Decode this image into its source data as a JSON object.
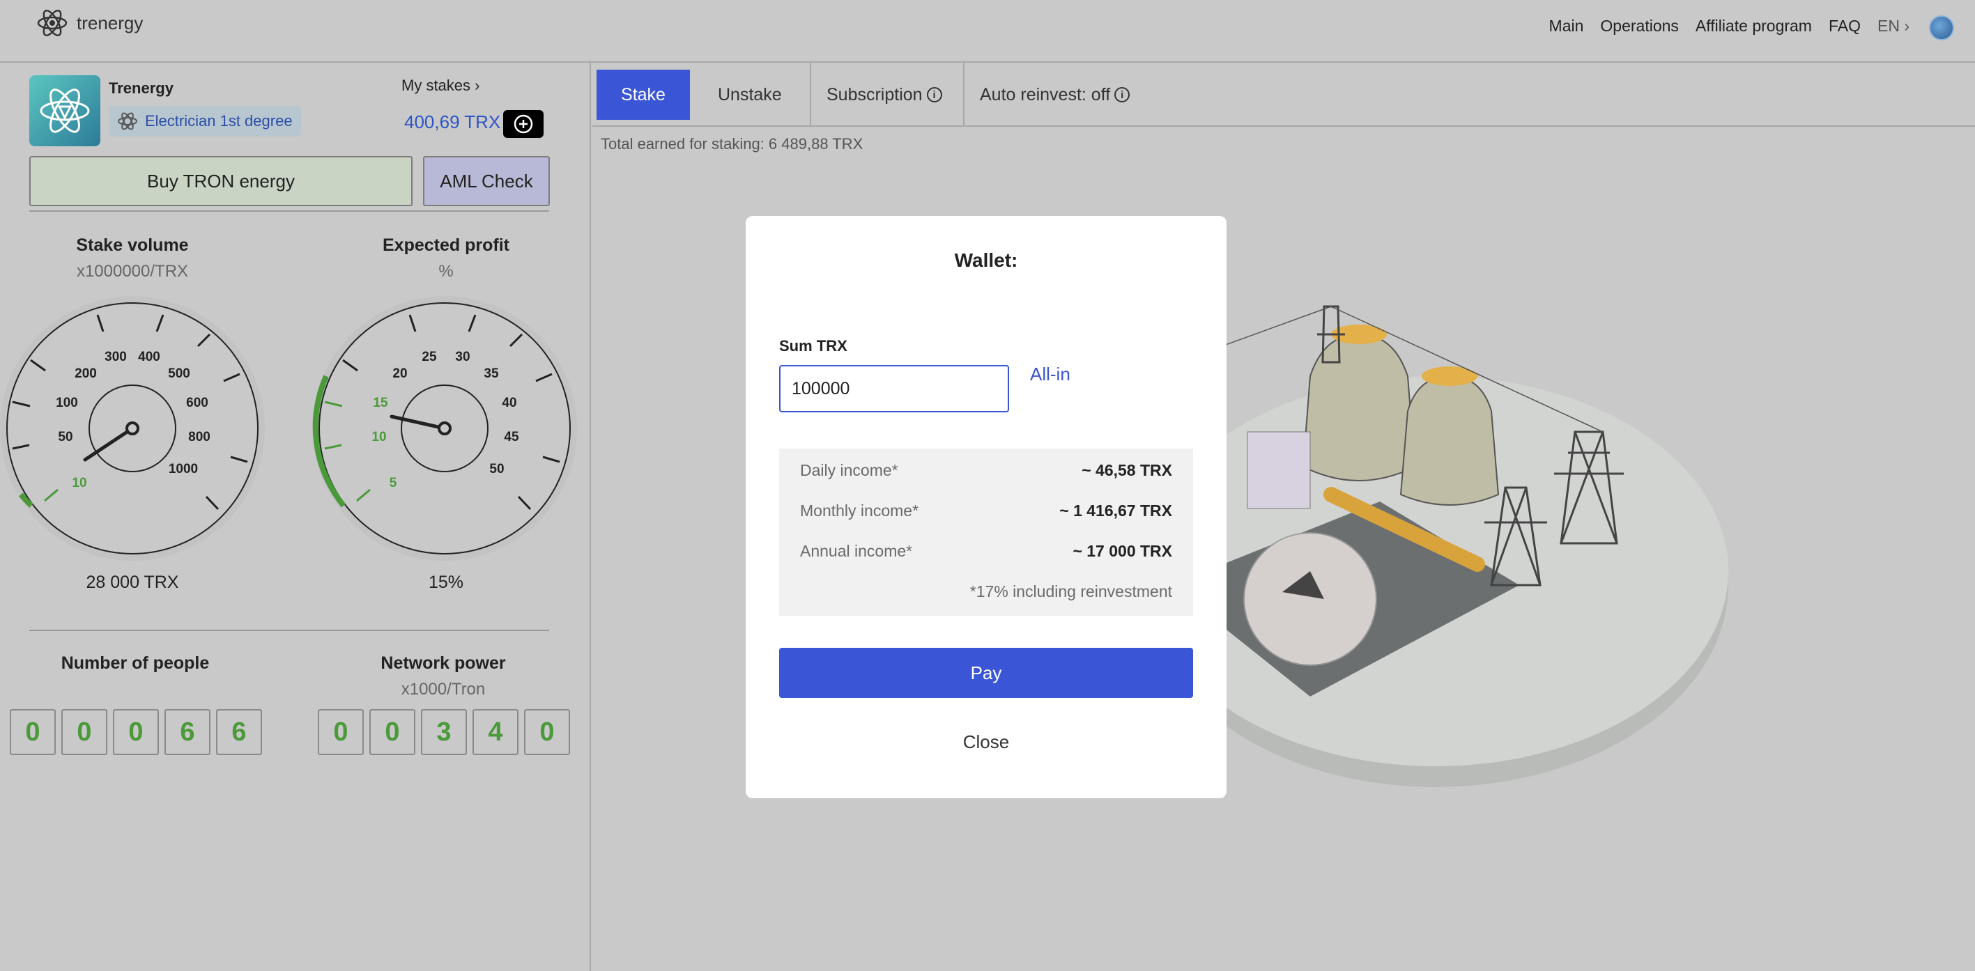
{
  "header": {
    "logo_text": "trenergy",
    "nav": [
      "Main",
      "Operations",
      "Affiliate program",
      "FAQ"
    ],
    "lang": "EN"
  },
  "profile": {
    "name": "Trenergy",
    "rank": "Electrician 1st degree",
    "my_stakes": "My stakes",
    "balance": "400,69 TRX"
  },
  "actions": {
    "buy_energy": "Buy TRON energy",
    "aml_check": "AML Check"
  },
  "gauges": {
    "stake": {
      "title": "Stake volume",
      "unit": "x1000000/TRX",
      "value": "28 000 TRX",
      "ticks": [
        "10",
        "50",
        "100",
        "200",
        "300",
        "400",
        "500",
        "600",
        "800",
        "1000"
      ]
    },
    "profit": {
      "title": "Expected profit",
      "unit": "%",
      "value": "15%",
      "ticks": [
        "5",
        "10",
        "15",
        "20",
        "25",
        "30",
        "35",
        "40",
        "45",
        "50"
      ]
    }
  },
  "counters": {
    "people": {
      "title": "Number of people",
      "unit": "",
      "digits": [
        "0",
        "0",
        "0",
        "6",
        "6"
      ]
    },
    "network": {
      "title": "Network power",
      "unit": "x1000/Tron",
      "digits": [
        "0",
        "0",
        "3",
        "4",
        "0"
      ]
    }
  },
  "tabs": {
    "stake": "Stake",
    "unstake": "Unstake",
    "subscription": "Subscription",
    "auto_reinvest": "Auto reinvest: off"
  },
  "total_earned": "Total earned for staking: 6 489,88 TRX",
  "modal": {
    "title": "Wallet:",
    "sum_label": "Sum TRX",
    "sum_value": "100000",
    "all_in": "All-in",
    "daily_label": "Daily income*",
    "daily_value": "~ 46,58 TRX",
    "monthly_label": "Monthly income*",
    "monthly_value": "~ 1 416,67 TRX",
    "annual_label": "Annual income*",
    "annual_value": "~ 17 000 TRX",
    "note": "*17% including reinvestment",
    "pay": "Pay",
    "close": "Close"
  },
  "colors": {
    "accent": "#3a55d6",
    "green": "#4a9a3a"
  }
}
